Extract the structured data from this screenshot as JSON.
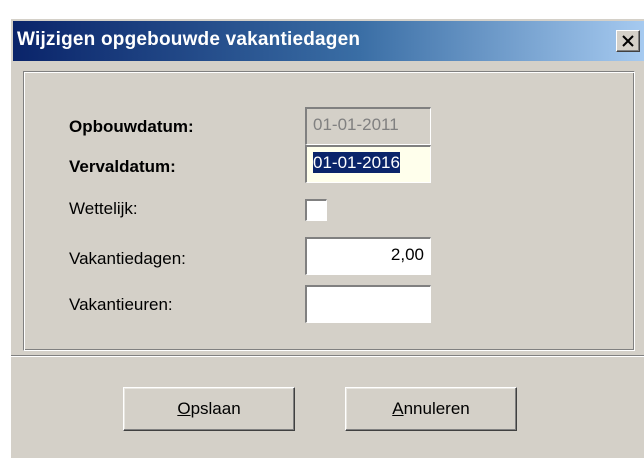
{
  "window": {
    "title": "Wijzigen opgebouwde vakantiedagen",
    "close_icon": "close-x-icon"
  },
  "form": {
    "opbouwdatum": {
      "label": "Opbouwdatum:",
      "value": "01-01-2011"
    },
    "vervaldatum": {
      "label": "Vervaldatum:",
      "value": "01-01-2016"
    },
    "wettelijk": {
      "label": "Wettelijk:",
      "checked": false
    },
    "vakantiedagen": {
      "label": "Vakantiedagen:",
      "value": "2,00"
    },
    "vakantieuren": {
      "label": "Vakantieuren:",
      "value": ""
    }
  },
  "buttons": {
    "save": {
      "mnemonic": "O",
      "rest": "pslaan"
    },
    "cancel": {
      "mnemonic": "A",
      "rest": "nnuleren"
    }
  },
  "colors": {
    "titlebar_start": "#0a246a",
    "titlebar_end": "#a6caf0",
    "face": "#d4d0c8",
    "selection": "#0a246a"
  }
}
